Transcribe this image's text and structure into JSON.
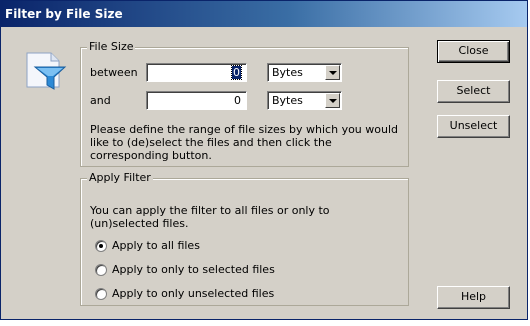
{
  "window": {
    "title": "Filter by File Size"
  },
  "file_size": {
    "legend": "File Size",
    "between_label": "between",
    "between_value": "0",
    "between_unit": "Bytes",
    "and_label": "and",
    "and_value": "0",
    "and_unit": "Bytes",
    "description": "Please define the range of file sizes by which you would like to (de)select the files and then click the corresponding button."
  },
  "apply_filter": {
    "legend": "Apply Filter",
    "description": "You can apply the filter to all files or only to (un)selected files.",
    "options": [
      {
        "label": "Apply to all files",
        "checked": true
      },
      {
        "label": "Apply to only to selected files",
        "checked": false
      },
      {
        "label": "Apply to only unselected files",
        "checked": false
      }
    ]
  },
  "buttons": {
    "close": "Close",
    "select": "Select",
    "unselect": "Unselect",
    "help": "Help"
  },
  "icons": {
    "dialog_icon": "document-filter-icon"
  }
}
